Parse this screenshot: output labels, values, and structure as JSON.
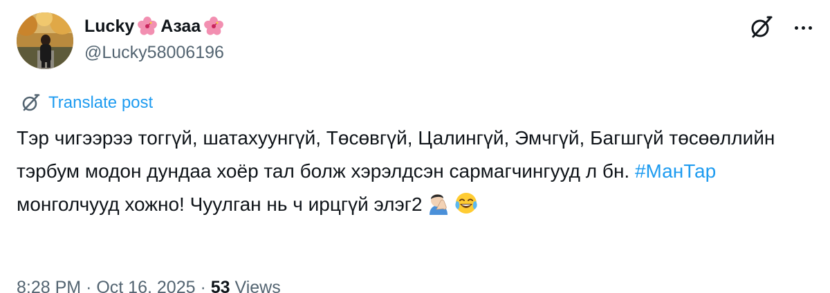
{
  "user": {
    "display_name": "Lucky",
    "display_name_suffix": "Азаа",
    "handle": "@Lucky58006196"
  },
  "translate_label": "Translate post",
  "tweet": {
    "text_before_hashtag": "Тэр чигээрээ тоггүй, шатахуунгүй, Төсөвгүй, Цалингүй, Эмчгүй, Багшгүй төсөөллийн тэрбум модон дундаа хоёр тал болж хэрэлдсэн сармагчингууд л бн. ",
    "hashtag": "#МанТар",
    "text_after_hashtag": " монголчууд хожно! Чуулган нь ч ирцгүй элэг2"
  },
  "meta": {
    "time": "8:28 PM",
    "date": "Oct 16, 2025",
    "separator": "·",
    "views_count": "53",
    "views_label": "Views"
  },
  "icons": {
    "name_emoji": "hibiscus-icon",
    "top_action": "grok-icon",
    "more": "more-icon",
    "translate": "translate-icon",
    "emoji_1": "man-facepalming-icon",
    "emoji_2": "face-with-tears-of-joy-icon"
  },
  "colors": {
    "link": "#1d9bf0",
    "secondary_text": "#536471",
    "primary_text": "#0f1419"
  }
}
